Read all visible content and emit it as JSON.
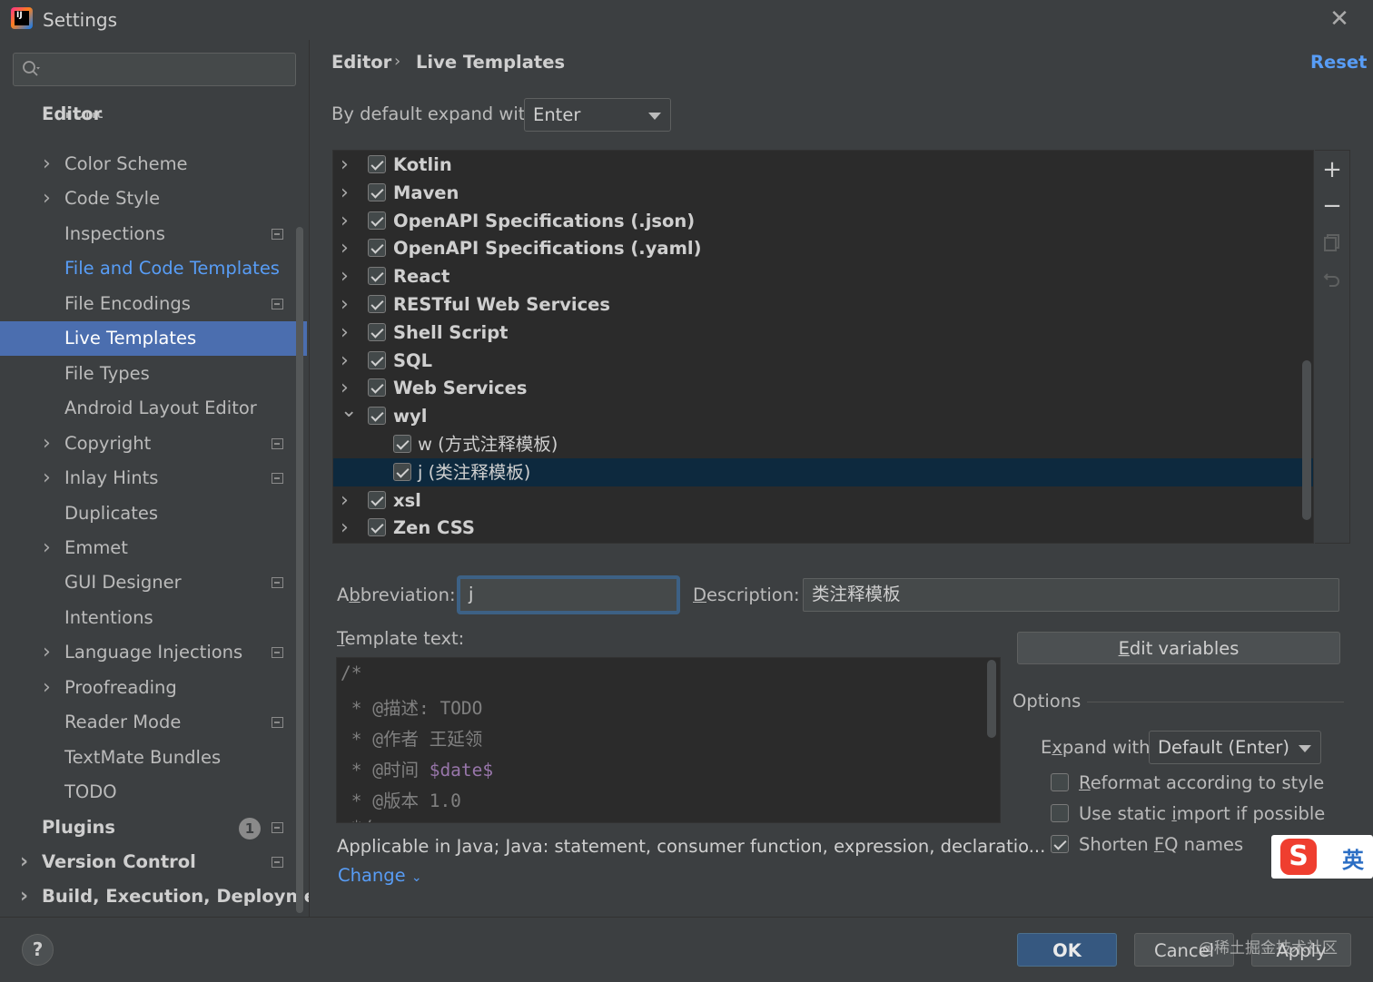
{
  "window": {
    "title": "Settings",
    "close_icon": "close-icon"
  },
  "search": {
    "placeholder": "",
    "value": ""
  },
  "sidebar": {
    "partial_item": "Font",
    "items": [
      {
        "label": "Editor",
        "bold": true
      },
      {
        "label": "Color Scheme",
        "chevron": true
      },
      {
        "label": "Code Style",
        "chevron": true
      },
      {
        "label": "Inspections",
        "project_icon": true
      },
      {
        "label": "File and Code Templates",
        "link": true
      },
      {
        "label": "File Encodings",
        "project_icon": true
      },
      {
        "label": "Live Templates",
        "selected": true
      },
      {
        "label": "File Types"
      },
      {
        "label": "Android Layout Editor"
      },
      {
        "label": "Copyright",
        "chevron": true,
        "project_icon": true
      },
      {
        "label": "Inlay Hints",
        "chevron": true,
        "project_icon": true
      },
      {
        "label": "Duplicates"
      },
      {
        "label": "Emmet",
        "chevron": true
      },
      {
        "label": "GUI Designer",
        "project_icon": true
      },
      {
        "label": "Intentions"
      },
      {
        "label": "Language Injections",
        "chevron": true,
        "project_icon": true
      },
      {
        "label": "Proofreading",
        "chevron": true
      },
      {
        "label": "Reader Mode",
        "project_icon": true
      },
      {
        "label": "TextMate Bundles"
      },
      {
        "label": "TODO"
      },
      {
        "label": "Plugins",
        "bold": true,
        "badge": "1",
        "project_icon": true
      },
      {
        "label": "Version Control",
        "bold": true,
        "chevron": true,
        "project_icon": true
      },
      {
        "label": "Build, Execution, Deploymen",
        "bold": true,
        "chevron": true
      }
    ]
  },
  "breadcrumb": {
    "parent": "Editor",
    "separator": "›",
    "current": "Live Templates"
  },
  "reset_label": "Reset",
  "expand": {
    "label": "By default expand with",
    "value": "Enter"
  },
  "templates": [
    {
      "name": "Kotlin",
      "level": 0,
      "expanded": false,
      "checked": true
    },
    {
      "name": "Maven",
      "level": 0,
      "expanded": false,
      "checked": true
    },
    {
      "name": "OpenAPI Specifications (.json)",
      "level": 0,
      "expanded": false,
      "checked": true
    },
    {
      "name": "OpenAPI Specifications (.yaml)",
      "level": 0,
      "expanded": false,
      "checked": true
    },
    {
      "name": "React",
      "level": 0,
      "expanded": false,
      "checked": true
    },
    {
      "name": "RESTful Web Services",
      "level": 0,
      "expanded": false,
      "checked": true
    },
    {
      "name": "Shell Script",
      "level": 0,
      "expanded": false,
      "checked": true
    },
    {
      "name": "SQL",
      "level": 0,
      "expanded": false,
      "checked": true
    },
    {
      "name": "Web Services",
      "level": 0,
      "expanded": false,
      "checked": true
    },
    {
      "name": "wyl",
      "level": 0,
      "expanded": true,
      "checked": true
    },
    {
      "name": "w (方式注释模板)",
      "level": 1,
      "checked": true
    },
    {
      "name": "j (类注释模板)",
      "level": 1,
      "checked": true,
      "selected": true
    },
    {
      "name": "xsl",
      "level": 0,
      "expanded": false,
      "checked": true
    },
    {
      "name": "Zen CSS",
      "level": 0,
      "expanded": false,
      "checked": true
    }
  ],
  "toolbar": {
    "add_icon": "plus-icon",
    "remove_icon": "minus-icon",
    "copy_icon": "copy-icon",
    "restore_icon": "undo-icon"
  },
  "abbreviation": {
    "label_pre": "A",
    "label_u": "b",
    "label_post": "breviation:",
    "value": "j"
  },
  "description": {
    "label_pre": "",
    "label_u": "D",
    "label_post": "escription:",
    "value": "类注释模板"
  },
  "template_text": {
    "label_u": "T",
    "label_post": "emplate text:",
    "lines": [
      {
        "text": "/*"
      },
      {
        "text": " * @描述: TODO"
      },
      {
        "text": " * @作者 王延领"
      },
      {
        "text": " * @时间 ",
        "var": "$date$"
      },
      {
        "text": " * @版本 1.0"
      },
      {
        "text": " */"
      }
    ]
  },
  "edit_variables": {
    "u": "E",
    "rest": "dit variables"
  },
  "options": {
    "title": "Options",
    "expand_label_pre": "E",
    "expand_label_u": "x",
    "expand_label_post": "pand with",
    "expand_value": "Default (Enter)",
    "checkboxes": [
      {
        "u": "R",
        "rest": "eformat according to style",
        "checked": false
      },
      {
        "pre": "Use static ",
        "u": "i",
        "rest": "mport if possible",
        "checked": false
      },
      {
        "pre": "Shorten ",
        "u": "F",
        "rest": "Q names",
        "checked": true
      }
    ]
  },
  "applicable": "Applicable in Java; Java: statement, consumer function, expression, declaratio...",
  "change_label": "Change",
  "buttons": {
    "ok": "OK",
    "cancel": "Cancel",
    "apply": "Apply",
    "help": "?"
  },
  "ime": {
    "logo": "S",
    "mode": "英"
  },
  "watermark": "@稀土掘金技术社区",
  "colors": {
    "selection": "#4b6eaf",
    "link": "#589df6",
    "tree_selection": "#0d293e",
    "primary_button": "#365880"
  }
}
